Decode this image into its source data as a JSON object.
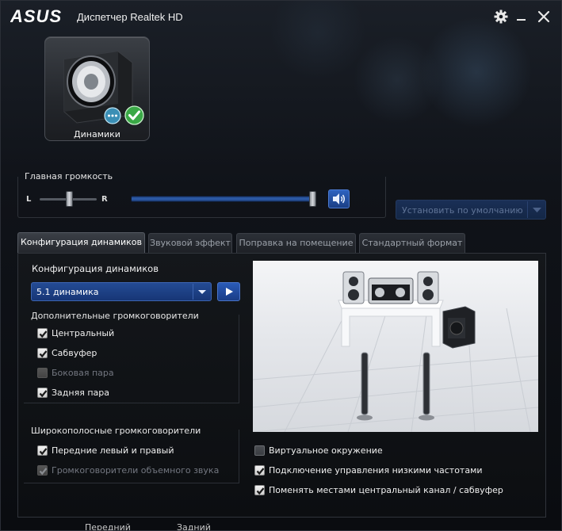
{
  "titlebar": {
    "brand": "ASUS",
    "title": "Диспетчер Realtek HD"
  },
  "device": {
    "label": "Динамики"
  },
  "volume": {
    "title": "Главная громкость",
    "left_label": "L",
    "right_label": "R",
    "balance_level": 0.5,
    "master_level": 1.0
  },
  "set_default": {
    "label": "Установить по умолчанию"
  },
  "tabs": [
    {
      "label": "Конфигурация динамиков"
    },
    {
      "label": "Звуковой эффект"
    },
    {
      "label": "Поправка на помещение"
    },
    {
      "label": "Стандартный формат"
    }
  ],
  "config": {
    "label": "Конфигурация динамиков",
    "selected": "5.1 динамика"
  },
  "optional_speakers": {
    "title": "Дополнительные громкоговорители",
    "items": [
      {
        "label": "Центральный",
        "checked": true,
        "enabled": true
      },
      {
        "label": "Сабвуфер",
        "checked": true,
        "enabled": true
      },
      {
        "label": "Боковая пара",
        "checked": false,
        "enabled": false
      },
      {
        "label": "Задняя пара",
        "checked": true,
        "enabled": true
      }
    ]
  },
  "fullrange": {
    "title": "Широкополосные громкоговорители",
    "items": [
      {
        "label": "Передние левый и правый",
        "checked": true,
        "enabled": true
      },
      {
        "label": "Громкоговорители объемного звука",
        "checked": true,
        "enabled": false
      }
    ]
  },
  "options": [
    {
      "label": "Виртуальное окружение",
      "checked": false
    },
    {
      "label": "Подключение управления низкими частотами",
      "checked": true
    },
    {
      "label": "Поменять местами центральный канал / сабвуфер",
      "checked": true
    }
  ],
  "bottom": {
    "front": "Передний",
    "rear": "Задний"
  },
  "colors": {
    "accent_blue": "#2f5fb0",
    "check_green": "#3aa846",
    "background": "#0b0d10"
  }
}
